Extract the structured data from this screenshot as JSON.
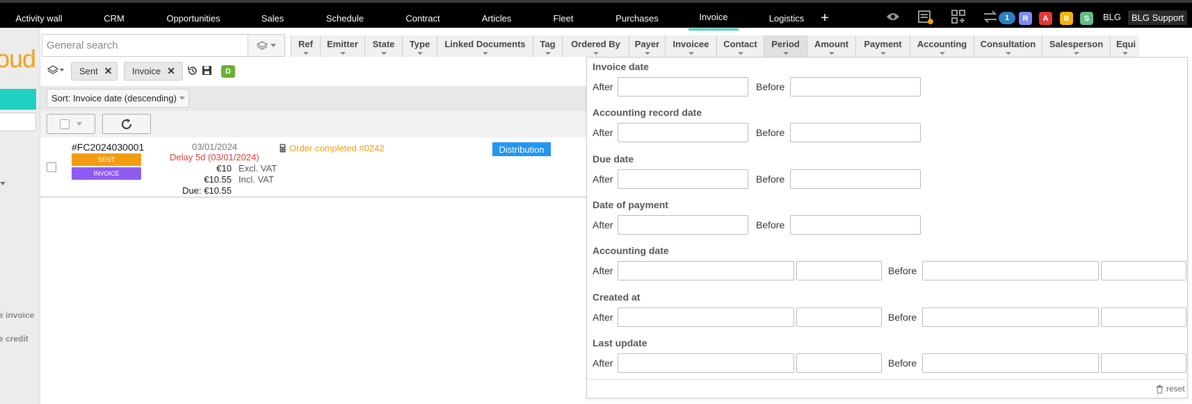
{
  "nav": {
    "items": [
      "Activity wall",
      "CRM",
      "Opportunities",
      "Sales",
      "Schedule",
      "Contract",
      "Articles",
      "Fleet",
      "Purchases",
      "Invoice",
      "Logistics"
    ],
    "active": "Invoice",
    "add_label": "+",
    "notif_count": "1",
    "badges": [
      {
        "label": "R",
        "color": "#7b8cf0"
      },
      {
        "label": "A",
        "color": "#e53935"
      },
      {
        "label": "B",
        "color": "#f4b400"
      },
      {
        "label": "S",
        "color": "#66bb8a"
      }
    ],
    "user_short": "BLG",
    "user_name": "BLG Support"
  },
  "sidebar": {
    "logo_fragment": "oud",
    "link1": "e invoice",
    "link2": "e credit"
  },
  "search": {
    "placeholder": "General search"
  },
  "columns": [
    "Ref",
    "Emitter",
    "State",
    "Type",
    "Linked Documents",
    "Tag",
    "Ordered By",
    "Payer",
    "Invoicee",
    "Contact",
    "Period",
    "Amount",
    "Payment",
    "Accounting",
    "Consultation",
    "Salesperson",
    "Equi"
  ],
  "filters": {
    "chips": [
      "Sent",
      "Invoice"
    ],
    "d_badge": "D"
  },
  "sort": {
    "label": "Sort: Invoice date (descending)"
  },
  "row": {
    "ref": "#FC2024030001",
    "state_tag": "SENT",
    "type_tag": "INVOICE",
    "date": "03/01/2024",
    "delay": "Delay 5d (03/01/2024)",
    "excl_amount": "€10",
    "excl_label": "Excl. VAT",
    "incl_amount": "€10.55",
    "incl_label": "Incl. VAT",
    "due": "Due: €10.55",
    "linked": "Order completed #0242",
    "tag": "Distribution"
  },
  "period_panel": {
    "after_label": "After",
    "before_label": "Before",
    "sections": [
      "Invoice date",
      "Accounting record date",
      "Due date",
      "Date of payment",
      "Accounting date",
      "Created at",
      "Last update"
    ],
    "reset": "reset"
  },
  "colors": {
    "accent": "#3fd1b8",
    "logo": "#f0a020",
    "sent": "#f39c12",
    "invoice": "#8e5cf0",
    "distribution": "#2196f3",
    "delay": "#e53935",
    "d_badge": "#6ab030"
  }
}
